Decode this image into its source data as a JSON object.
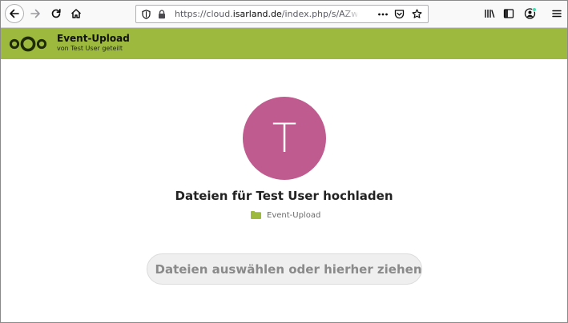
{
  "browser": {
    "url_prefix": "https://cloud.",
    "url_domain": "isarland.de",
    "url_path": "/index.php/s/AZwdqLc",
    "icons": [
      "back-icon",
      "forward-icon",
      "reload-icon",
      "home-icon",
      "shield-icon",
      "lock-icon",
      "more-icon",
      "pocket-icon",
      "bookmark-star-icon",
      "library-icon",
      "sidebar-icon",
      "account-icon",
      "menu-icon"
    ],
    "notification_color": "#3fe1b0"
  },
  "header": {
    "title": "Event-Upload",
    "subtitle": "von Test User geteilt",
    "brand_color": "#9eba3e",
    "logo": "nextcloud-logo"
  },
  "main": {
    "avatar_letter": "T",
    "avatar_color": "#bf5b8e",
    "heading": "Dateien für Test User hochladen",
    "folder_name": "Event-Upload",
    "folder_color": "#9eba3e",
    "upload_label": "Dateien auswählen oder hierher ziehen"
  }
}
